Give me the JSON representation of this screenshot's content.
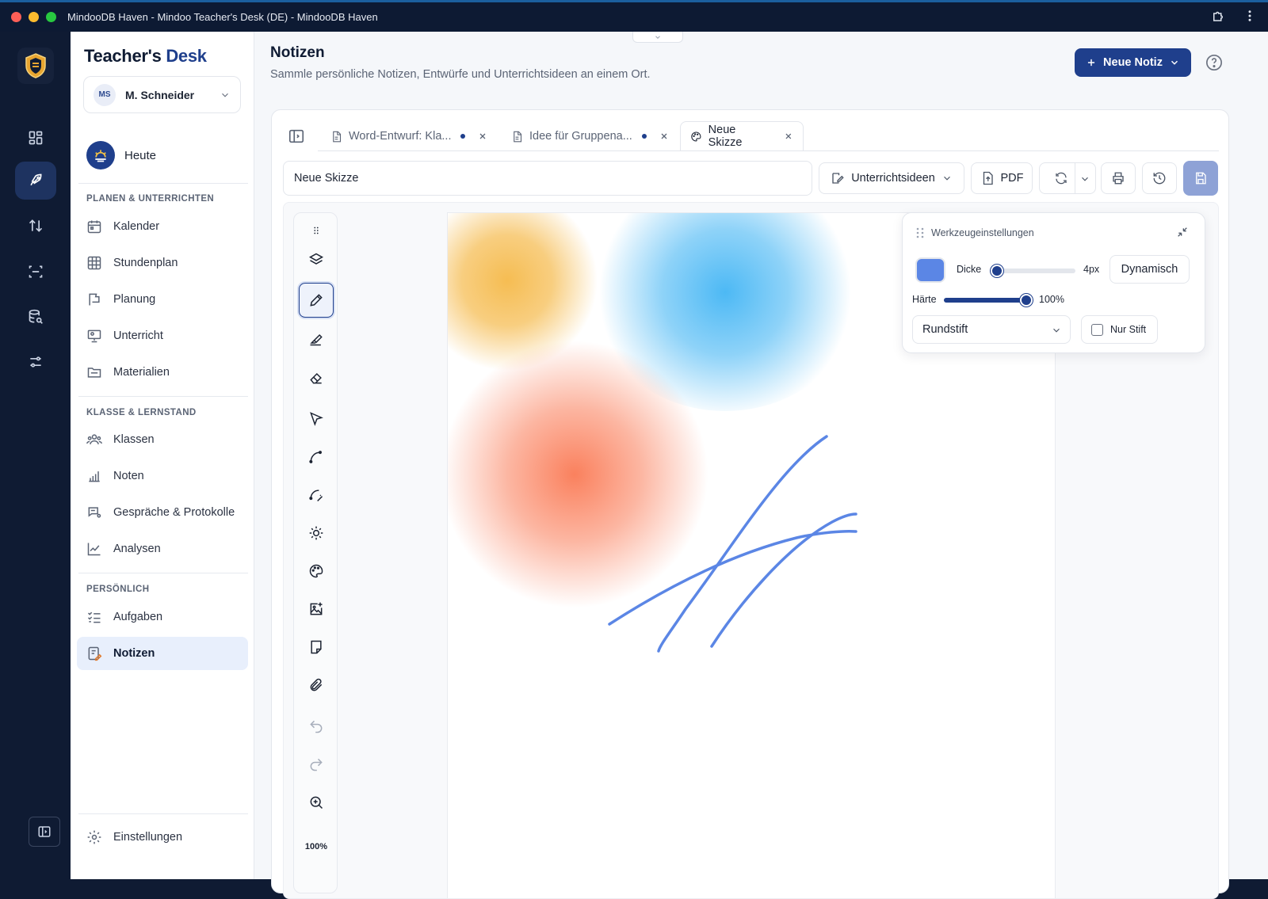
{
  "window": {
    "title": "MindooDB Haven - Mindoo Teacher's Desk (DE) - MindooDB Haven"
  },
  "brand": {
    "part1": "Teacher's",
    "part2": "Desk"
  },
  "user": {
    "initials": "MS",
    "name": "M. Schneider"
  },
  "sidebar": {
    "today_label": "Heute",
    "sections": [
      {
        "heading": "PLANEN & UNTERRICHTEN",
        "items": [
          {
            "label": "Kalender",
            "icon": "calendar-icon"
          },
          {
            "label": "Stundenplan",
            "icon": "grid-icon"
          },
          {
            "label": "Planung",
            "icon": "flag-icon"
          },
          {
            "label": "Unterricht",
            "icon": "presentation-icon"
          },
          {
            "label": "Materialien",
            "icon": "folder-icon"
          }
        ]
      },
      {
        "heading": "KLASSE & LERNSTAND",
        "items": [
          {
            "label": "Klassen",
            "icon": "users-icon"
          },
          {
            "label": "Noten",
            "icon": "bar-chart-icon"
          },
          {
            "label": "Gespräche & Protokolle",
            "icon": "chat-icon"
          },
          {
            "label": "Analysen",
            "icon": "trend-icon"
          }
        ]
      },
      {
        "heading": "PERSÖNLICH",
        "items": [
          {
            "label": "Aufgaben",
            "icon": "checklist-icon"
          },
          {
            "label": "Notizen",
            "icon": "notes-icon",
            "active": true
          }
        ]
      }
    ],
    "settings_label": "Einstellungen"
  },
  "header": {
    "title": "Notizen",
    "subtitle": "Sammle persönliche Notizen, Entwürfe und Unterrichtsideen an einem Ort.",
    "new_button": "Neue Notiz"
  },
  "tabs": [
    {
      "label": "Word-Entwurf: Kla...",
      "unsaved": true,
      "active": false
    },
    {
      "label": "Idee für Gruppena...",
      "unsaved": true,
      "active": false
    },
    {
      "label": "Neue Skizze",
      "unsaved": false,
      "active": true
    }
  ],
  "editor": {
    "note_title": "Neue Skizze",
    "category": "Unterrichtsideen",
    "pdf_label": "PDF",
    "zoom": "100%"
  },
  "tool_settings": {
    "title": "Werkzeugeinstellungen",
    "color": "#5b86e5",
    "thickness_label": "Dicke",
    "thickness_value": "4px",
    "thickness_level": 0.08,
    "dynamic_label": "Dynamisch",
    "hardness_label": "Härte",
    "hardness_value": "100%",
    "hardness_level": 1.0,
    "brush": "Rundstift",
    "pen_only_label": "Nur Stift",
    "pen_only": false
  },
  "colors": {
    "accent": "#1f3f8c",
    "blob_orange": "#f5b949",
    "blob_blue": "#43b5f4",
    "blob_red": "#fa7a55",
    "stroke": "#5b86e5"
  }
}
